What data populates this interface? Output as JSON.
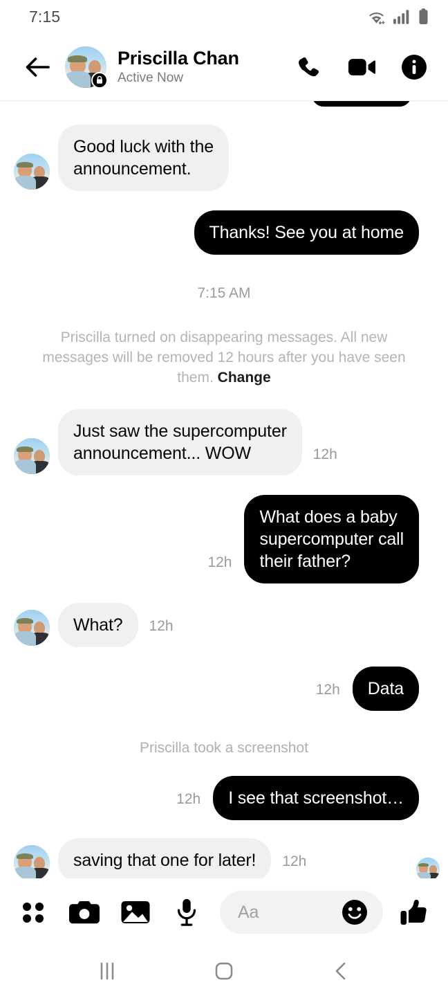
{
  "status_bar": {
    "time": "7:15",
    "icons": [
      "wifi-icon",
      "cellular-signal-icon",
      "battery-icon"
    ]
  },
  "header": {
    "back_icon": "back-arrow-icon",
    "avatar": "contact-avatar",
    "lock_badge": "lock-icon",
    "name": "Priscilla Chan",
    "status": "Active Now",
    "actions": [
      {
        "name": "audio-call-button",
        "icon": "phone-icon"
      },
      {
        "name": "video-call-button",
        "icon": "video-camera-icon"
      },
      {
        "name": "conversation-info-button",
        "icon": "info-icon"
      }
    ]
  },
  "thread": {
    "items": [
      {
        "kind": "cut-bubble",
        "side": "out"
      },
      {
        "kind": "message",
        "side": "in",
        "text": "Good luck with the\nannouncement.",
        "timestamp": "",
        "avatar": true
      },
      {
        "kind": "message",
        "side": "out",
        "text": "Thanks! See you at home",
        "timestamp": ""
      },
      {
        "kind": "time-divider",
        "text": "7:15 AM"
      },
      {
        "kind": "system",
        "text": "Priscilla turned on disappearing messages. All new messages will be removed 12 hours after you have seen them.",
        "action": "Change"
      },
      {
        "kind": "message",
        "side": "in",
        "text": "Just saw the supercomputer\nannouncement... WOW",
        "timestamp": "12h",
        "avatar": true
      },
      {
        "kind": "message",
        "side": "out",
        "text": "What does a baby\nsupercomputer call\ntheir father?",
        "timestamp": "12h"
      },
      {
        "kind": "message",
        "side": "in",
        "text": "What?",
        "timestamp": "12h",
        "avatar": true
      },
      {
        "kind": "message",
        "side": "out",
        "text": "Data",
        "timestamp": "12h"
      },
      {
        "kind": "system2",
        "text": "Priscilla took a screenshot"
      },
      {
        "kind": "message",
        "side": "out",
        "text": "I see that screenshot…",
        "timestamp": "12h"
      },
      {
        "kind": "message",
        "side": "in",
        "text": "saving that one for later!",
        "timestamp": "12h",
        "avatar": true
      },
      {
        "kind": "read-receipt",
        "avatar": true
      }
    ]
  },
  "composer": {
    "icons": [
      {
        "name": "more-apps-button",
        "icon": "four-dot-grid-icon"
      },
      {
        "name": "camera-button",
        "icon": "camera-icon"
      },
      {
        "name": "gallery-button",
        "icon": "image-icon"
      },
      {
        "name": "voice-message-button",
        "icon": "microphone-icon"
      }
    ],
    "input_placeholder": "Aa",
    "emoji_icon": "smiley-face-icon",
    "like_icon": "thumbs-up-icon"
  },
  "nav_bar": {
    "recents": "recents-icon",
    "home": "home-icon",
    "back": "back-icon"
  },
  "colors": {
    "outgoing_bubble": "#000000",
    "incoming_bubble": "#f0f0f0",
    "incoming_text": "#050505",
    "outgoing_text": "#ffffff",
    "timestamp": "#9a9a9a",
    "system_text": "#b4b4b4",
    "background": "#ffffff"
  }
}
